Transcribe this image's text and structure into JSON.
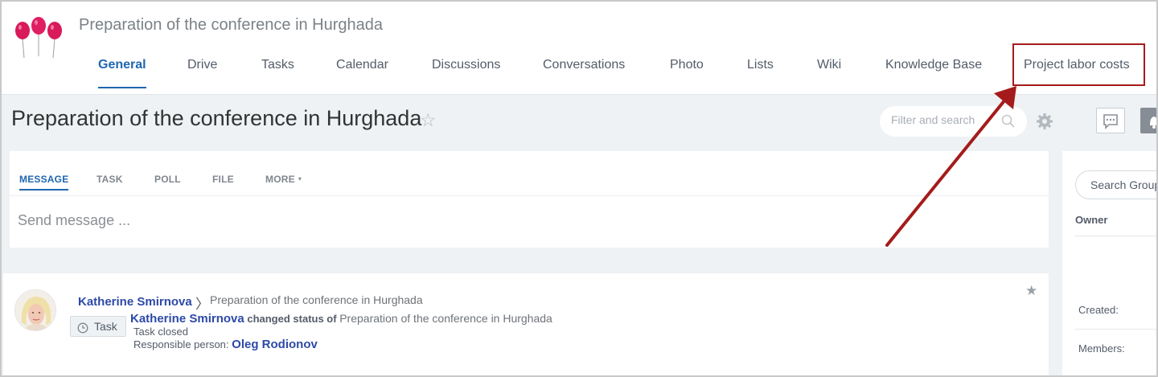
{
  "group": {
    "name": "Preparation of the conference in Hurghada"
  },
  "nav": {
    "items": [
      {
        "label": "General"
      },
      {
        "label": "Drive"
      },
      {
        "label": "Tasks"
      },
      {
        "label": "Calendar"
      },
      {
        "label": "Discussions"
      },
      {
        "label": "Conversations"
      },
      {
        "label": "Photo"
      },
      {
        "label": "Lists"
      },
      {
        "label": "Wiki"
      },
      {
        "label": "Knowledge Base"
      },
      {
        "label": "Project labor costs"
      }
    ],
    "active_index": 0,
    "highlighted_index": 10
  },
  "title_bar": {
    "title": "Preparation of the conference in Hurghada",
    "star_glyph": "☆",
    "filter_placeholder": "Filter and search"
  },
  "composer": {
    "tabs": [
      "MESSAGE",
      "TASK",
      "POLL",
      "FILE",
      "MORE"
    ],
    "more_caret": "▾",
    "placeholder": "Send message ..."
  },
  "post": {
    "author": "Katherine Smirnova",
    "chevron": "〉",
    "destination": "Preparation of the conference in Hurghada",
    "badge_label": "Task",
    "line1": {
      "actor": "Katherine Smirnova",
      "action": "changed status of",
      "object": "Preparation of the conference in Hurghada"
    },
    "status": "Task closed",
    "responsible_label": "Responsible person:",
    "responsible_name": "Oleg Rodionov",
    "star_glyph": "★"
  },
  "side_panel": {
    "search_placeholder": "Search Group",
    "owner_label": "Owner",
    "created_label": "Created:",
    "members_label": "Members:"
  },
  "colors": {
    "accent": "#2067b0",
    "link": "#2d4aa7",
    "annotation": "#a51b1b",
    "balloon": "#d8195a"
  },
  "icons": [
    "balloons-logo",
    "star-icon",
    "search-icon",
    "gear-icon",
    "chat-icon",
    "bell-icon",
    "clock-icon",
    "chevron-right-icon",
    "annotation-arrow"
  ]
}
